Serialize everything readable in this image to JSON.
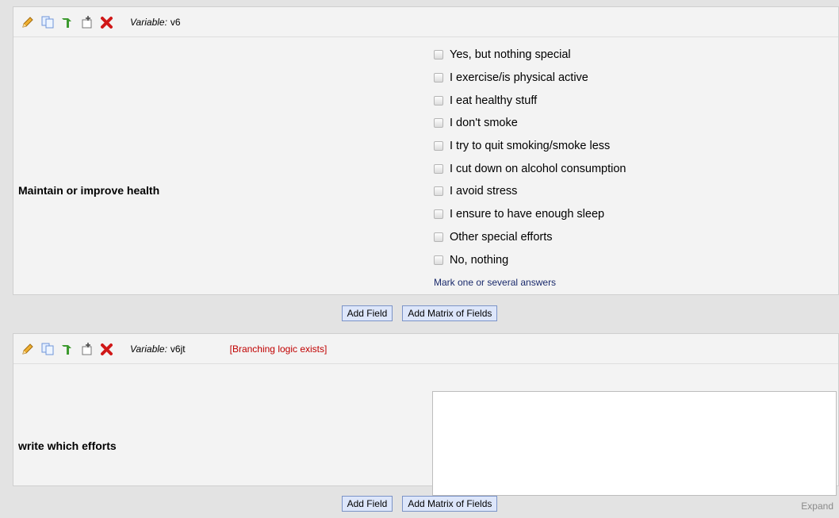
{
  "fields": [
    {
      "variable_label": "Variable:",
      "variable_name": "v6",
      "branching_note": "",
      "question": "Maintain or improve health",
      "options": [
        "Yes, but nothing special",
        "I exercise/is physical active",
        "I eat healthy stuff",
        "I don't smoke",
        "I try to quit smoking/smoke less",
        "I cut down on alcohol consumption",
        "I avoid stress",
        "I ensure to have enough sleep",
        "Other special efforts",
        "No, nothing"
      ],
      "note": "Mark one or several answers"
    },
    {
      "variable_label": "Variable:",
      "variable_name": "v6jt",
      "branching_note": "[Branching logic exists]",
      "question": "write which efforts",
      "expand_label": "Expand"
    }
  ],
  "buttons": {
    "add_field": "Add Field",
    "add_matrix": "Add Matrix of Fields"
  },
  "icons": [
    "pencil-icon",
    "copy-icon",
    "branch-icon",
    "move-icon",
    "delete-icon"
  ],
  "colors": {
    "branch_note": "#c00000",
    "note": "#1a2a6c",
    "button_bg": "#dde6fa",
    "button_border": "#7b93c7"
  }
}
